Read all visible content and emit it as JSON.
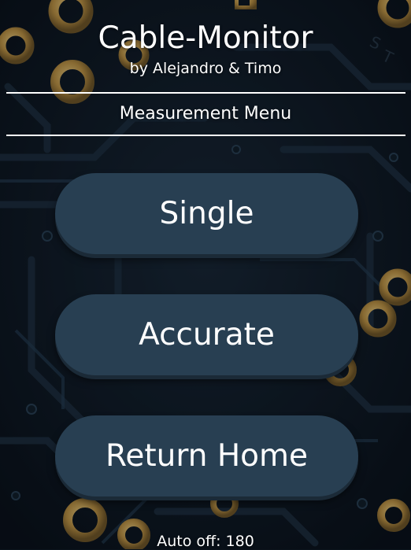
{
  "header": {
    "title": "Cable-Monitor",
    "subtitle": "by Alejandro & Timo"
  },
  "menu": {
    "title": "Measurement Menu",
    "buttons": [
      {
        "label": "Single"
      },
      {
        "label": "Accurate"
      },
      {
        "label": "Return Home"
      }
    ]
  },
  "footer": {
    "auto_off": "Auto off: 180"
  },
  "colors": {
    "button_fill": "#283f52",
    "button_shadow": "#1b2a37",
    "text": "#ffffff",
    "background": "#0b131b",
    "pad_gold": "#c9a04a"
  },
  "background": {
    "description_icon": "circuit-board-background"
  }
}
